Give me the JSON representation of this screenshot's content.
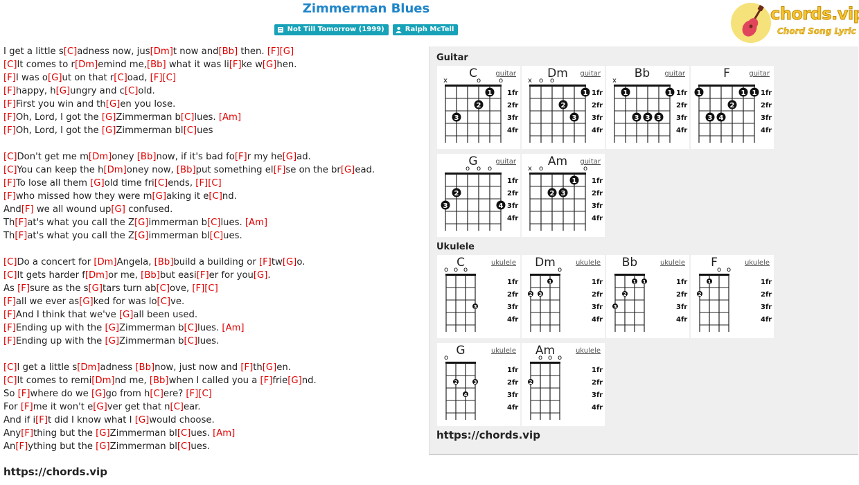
{
  "song": {
    "title": "Zimmerman Blues",
    "album": "Not Till Tomorrow (1999)",
    "artist": "Ralph McTell"
  },
  "logo": {
    "name": "chords.vip",
    "tagline": "Chord Song Lyric"
  },
  "lyrics": [
    "I get a little s[C]adness now, jus[Dm]t now and[Bb] then. [F][G]",
    "[C]It comes to r[Dm]emind me,[Bb] what it was li[F]ke w[G]hen.",
    "[F]I was o[G]ut on that r[C]oad, [F][C]",
    "[F]happy, h[G]ungry and c[C]old.",
    "[F]First you win and th[G]en you lose.",
    "[F]Oh, Lord, I got the [G]Zimmerman b[C]lues. [Am]",
    "[F]Oh, Lord, I got the [G]Zimmerman bl[C]ues",
    "",
    "[C]Don't get me m[Dm]oney [Bb]now, if it's bad fo[F]r my he[G]ad.",
    "[C]You can keep the h[Dm]oney now, [Bb]put something el[F]se on the br[G]ead.",
    "[F]To lose all them [G]old time fri[C]ends, [F][C]",
    "[F]who missed how they were m[G]aking it e[C]nd.",
    "And[F] we all wound up[G] confused.",
    "Th[F]at's what you call the Z[G]immerman b[C]lues. [Am]",
    "Th[F]at's what you call the Z[G]immerman bl[C]ues.",
    "",
    "[C]Do a concert for [Dm]Angela, [Bb]build a building or [F]tw[G]o.",
    "[C]It gets harder f[Dm]or me, [Bb]but easi[F]er for you[G].",
    "As [F]sure as the s[G]tars turn ab[C]ove, [F][C]",
    "[F]all we ever as[G]ked for was lo[C]ve.",
    "[F]And I think that we've [G]all been used.",
    "[F]Ending up with the [G]Zimmerman b[C]lues. [Am]",
    "[F]Ending up with the [G]Zimmerman b[C]lues.",
    "",
    "[C]I get a little s[Dm]adness [Bb]now, just now and [F]th[G]en.",
    "[C]It comes to remi[Dm]nd me, [Bb]when I called you a [F]frie[G]nd.",
    "So [F]where do we [G]go from h[C]ere? [F][C]",
    "For [F]me it won't e[G]ver get that n[C]ear.",
    "And if i[F]t did I know what I [G]would choose.",
    "Any[F]thing but the [G]Zimmerman bl[C]ues. [Am]",
    "An[F]ything but the [G]Zimmerman bl[C]ues."
  ],
  "footer_url": "https://chords.vip",
  "panel": {
    "guitar_label": "Guitar",
    "ukulele_label": "Ukulele",
    "footer_url": "https://chords.vip",
    "fret_labels": [
      "1fr",
      "2fr",
      "3fr",
      "4fr"
    ],
    "guitar": [
      {
        "chord": "C",
        "link": "guitar",
        "top": [
          "x",
          "",
          "",
          "o",
          "",
          "o"
        ],
        "dots": [
          [
            5,
            1,
            "1"
          ],
          [
            4,
            2,
            "2"
          ],
          [
            2,
            3,
            "3"
          ]
        ]
      },
      {
        "chord": "Dm",
        "link": "guitar",
        "top": [
          "x",
          "o",
          "o",
          "",
          "",
          ""
        ],
        "dots": [
          [
            6,
            1,
            "1"
          ],
          [
            4,
            2,
            "2"
          ],
          [
            5,
            3,
            "3"
          ]
        ]
      },
      {
        "chord": "Bb",
        "link": "guitar",
        "top": [
          "x",
          "",
          "",
          "",
          "",
          ""
        ],
        "dots": [
          [
            2,
            1,
            "1"
          ],
          [
            6,
            1,
            "1"
          ],
          [
            3,
            3,
            "3"
          ],
          [
            4,
            3,
            "3"
          ],
          [
            5,
            3,
            "3"
          ]
        ]
      },
      {
        "chord": "F",
        "link": "guitar",
        "top": [
          "",
          "",
          "",
          "",
          "",
          ""
        ],
        "dots": [
          [
            1,
            1,
            "1"
          ],
          [
            5,
            1,
            "1"
          ],
          [
            6,
            1,
            "1"
          ],
          [
            4,
            2,
            "2"
          ],
          [
            2,
            3,
            "3"
          ],
          [
            3,
            3,
            "4"
          ]
        ]
      },
      {
        "chord": "G",
        "link": "guitar",
        "top": [
          "",
          "",
          "o",
          "o",
          "o",
          ""
        ],
        "dots": [
          [
            2,
            2,
            "2"
          ],
          [
            1,
            3,
            "3"
          ],
          [
            6,
            3,
            "4"
          ]
        ]
      },
      {
        "chord": "Am",
        "link": "guitar",
        "top": [
          "x",
          "o",
          "",
          "",
          "",
          "o"
        ],
        "dots": [
          [
            5,
            1,
            "1"
          ],
          [
            3,
            2,
            "2"
          ],
          [
            4,
            2,
            "3"
          ]
        ]
      }
    ],
    "ukulele": [
      {
        "chord": "C",
        "link": "ukulele",
        "top": [
          "o",
          "o",
          "o",
          ""
        ],
        "dots": [
          [
            4,
            3,
            "3"
          ]
        ]
      },
      {
        "chord": "Dm",
        "link": "ukulele",
        "top": [
          "",
          "",
          "",
          "o"
        ],
        "dots": [
          [
            3,
            1,
            "1"
          ],
          [
            1,
            2,
            "2"
          ],
          [
            2,
            2,
            "3"
          ]
        ]
      },
      {
        "chord": "Bb",
        "link": "ukulele",
        "top": [
          "",
          "",
          "",
          ""
        ],
        "dots": [
          [
            3,
            1,
            "1"
          ],
          [
            4,
            1,
            "1"
          ],
          [
            2,
            2,
            "2"
          ],
          [
            1,
            3,
            "3"
          ]
        ]
      },
      {
        "chord": "F",
        "link": "ukulele",
        "top": [
          "",
          "",
          "o",
          "o"
        ],
        "dots": [
          [
            2,
            1,
            "1"
          ],
          [
            1,
            2,
            "2"
          ]
        ]
      },
      {
        "chord": "G",
        "link": "ukulele",
        "top": [
          "o",
          "",
          "",
          ""
        ],
        "dots": [
          [
            2,
            2,
            "2"
          ],
          [
            4,
            2,
            "3"
          ],
          [
            3,
            3,
            "4"
          ]
        ]
      },
      {
        "chord": "Am",
        "link": "ukulele",
        "top": [
          "",
          "o",
          "o",
          "o"
        ],
        "dots": [
          [
            1,
            2,
            "2"
          ]
        ]
      }
    ]
  }
}
